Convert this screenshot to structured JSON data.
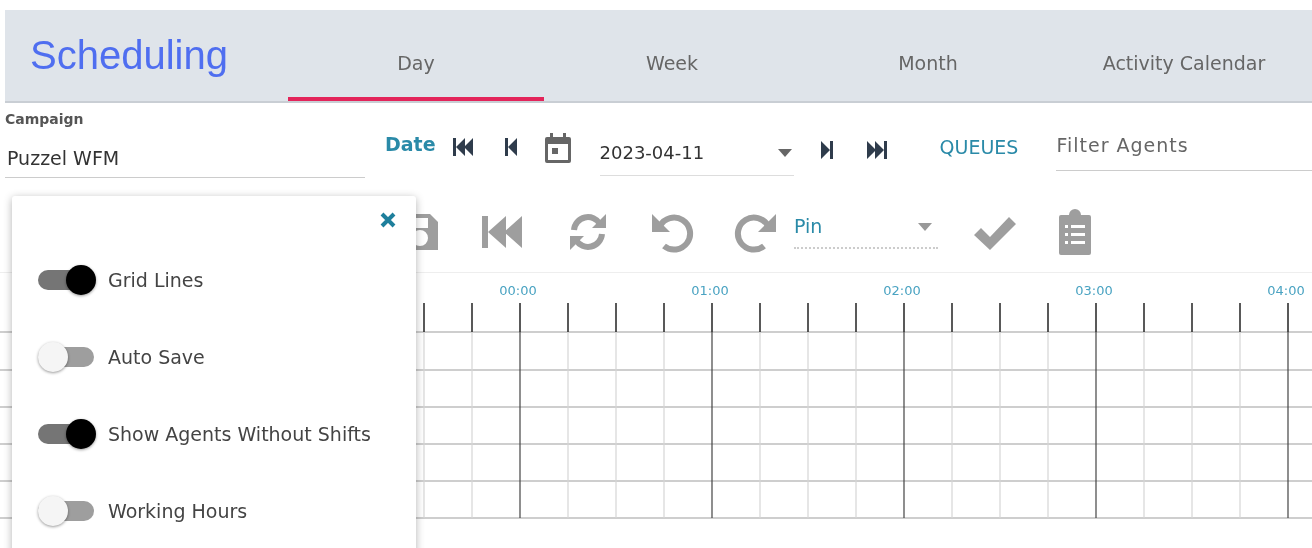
{
  "header": {
    "title": "Scheduling"
  },
  "tabs": [
    {
      "label": "Day",
      "selected": true
    },
    {
      "label": "Week",
      "selected": false
    },
    {
      "label": "Month",
      "selected": false
    },
    {
      "label": "Activity Calendar",
      "selected": false
    }
  ],
  "campaign": {
    "label": "Campaign",
    "value": "Puzzel WFM"
  },
  "date_bar": {
    "label": "Date",
    "value": "2023-04-11"
  },
  "queues_button": "QUEUES",
  "filter": {
    "placeholder": "Filter Agents"
  },
  "toolbar": {
    "pin_label": "Pin"
  },
  "timeline": {
    "hours": [
      "00:00",
      "01:00",
      "02:00",
      "03:00",
      "04:00"
    ]
  },
  "settings_panel": {
    "toggles": [
      {
        "label": "Grid Lines",
        "on": true
      },
      {
        "label": "Auto Save",
        "on": false
      },
      {
        "label": "Show Agents Without Shifts",
        "on": true
      },
      {
        "label": "Working Hours",
        "on": false
      }
    ]
  }
}
